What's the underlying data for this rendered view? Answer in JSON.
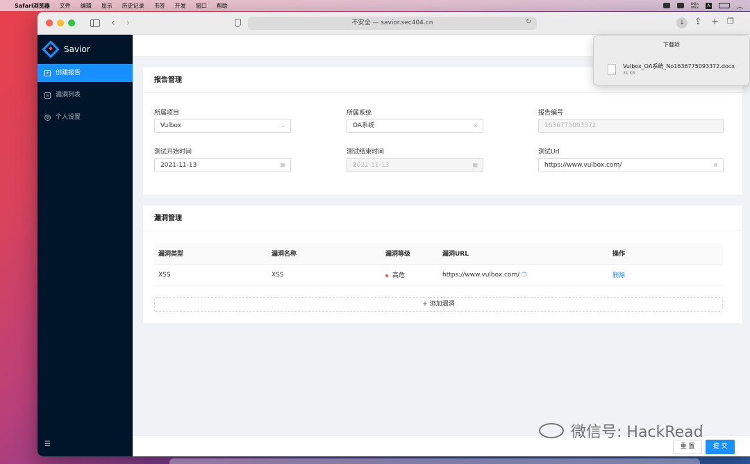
{
  "menubar": {
    "items": [
      "Safari浏览器",
      "文件",
      "编辑",
      "显示",
      "历史记录",
      "书签",
      "开发",
      "窗口",
      "帮助"
    ],
    "speed_up": "0KB/s",
    "speed_down": "0KB/s"
  },
  "browser": {
    "url_text": "不安全 — savior.sec404.cn"
  },
  "downloads": {
    "title": "下载项",
    "file_name": "Vulbox_OA系统_No1636775093372.docx",
    "file_size": "31 KB"
  },
  "app": {
    "name": "Savior",
    "nav": [
      "创建报告",
      "漏洞列表",
      "个人设置"
    ]
  },
  "report": {
    "title": "报告管理",
    "project_label": "所属项目",
    "project_value": "Vulbox",
    "system_label": "所属系统",
    "system_value": "OA系统",
    "number_label": "报告编号",
    "number_value": "1636775093372",
    "start_label": "测试开始时间",
    "start_value": "2021-11-13",
    "end_label": "测试结束时间",
    "end_value": "2021-11-13",
    "url_label": "测试Url",
    "url_value": "https://www.vulbox.com/"
  },
  "vuln": {
    "title": "漏洞管理",
    "columns": [
      "漏洞类型",
      "漏洞名称",
      "漏洞等级",
      "漏洞URL",
      "操作"
    ],
    "rows": [
      {
        "type": "XSS",
        "name": "XSS",
        "level": "高危",
        "url": "https://www.vulbox.com/",
        "action": "删除"
      }
    ],
    "add_label": "+ 添加漏洞"
  },
  "footer": {
    "reset": "重 置",
    "submit": "提 交"
  },
  "watermark": "微信号: HackRead",
  "colors": {
    "primary": "#1890ff",
    "sidebar_bg": "#001529",
    "danger": "#ff4d4f"
  }
}
